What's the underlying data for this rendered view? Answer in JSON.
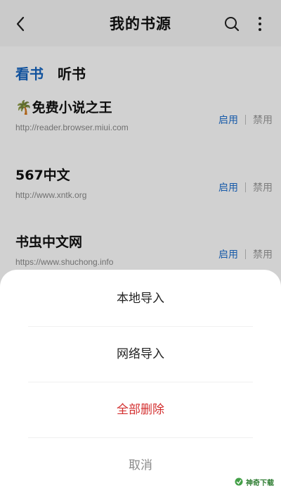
{
  "header": {
    "title": "我的书源",
    "back_icon": "chevron-left-icon",
    "search_icon": "search-icon",
    "more_icon": "more-vertical-icon"
  },
  "tabs": [
    {
      "label": "看书",
      "active": true
    },
    {
      "label": "听书",
      "active": false
    }
  ],
  "sources": [
    {
      "emoji": "🌴",
      "name": "免费小说之王",
      "url": "http://reader.browser.miui.com",
      "enable": "启用",
      "disable": "禁用"
    },
    {
      "name": "567中文",
      "url": "http://www.xntk.org",
      "enable": "启用",
      "disable": "禁用"
    },
    {
      "name": "书虫中文网",
      "url": "https://www.shuchong.info",
      "enable": "启用",
      "disable": "禁用"
    }
  ],
  "sheet": {
    "items": [
      {
        "label": "本地导入"
      },
      {
        "label": "网络导入"
      },
      {
        "label": "全部删除"
      },
      {
        "label": "取消"
      }
    ]
  },
  "watermark": {
    "text": "神奇下载"
  },
  "colors": {
    "accent": "#1565c0",
    "danger": "#d32f2f"
  }
}
